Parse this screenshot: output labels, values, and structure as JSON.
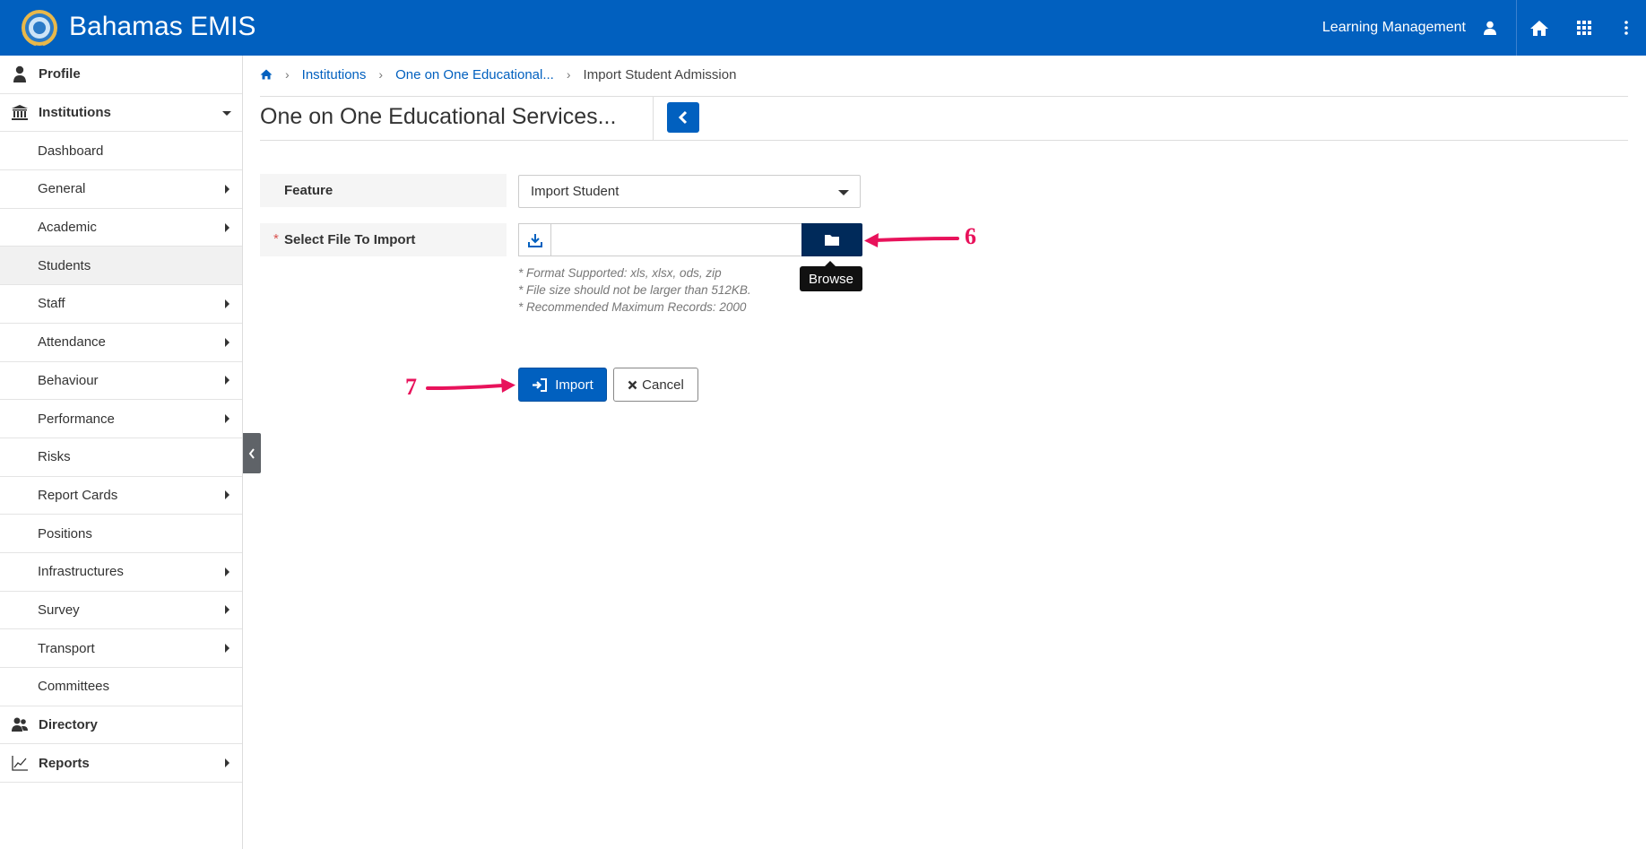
{
  "header": {
    "app_title": "Bahamas EMIS",
    "module_label": "Learning Management",
    "brand_color": "#0160bf",
    "icons": [
      "user-icon",
      "home-icon",
      "apps-grid-icon",
      "more-vertical-icon"
    ]
  },
  "sidebar": {
    "items": [
      {
        "label": "Profile",
        "level": "top",
        "icon": "user-icon"
      },
      {
        "label": "Institutions",
        "level": "top",
        "icon": "institution-icon",
        "expanded": true
      },
      {
        "label": "Dashboard",
        "level": "sub"
      },
      {
        "label": "General",
        "level": "sub",
        "has_children": true
      },
      {
        "label": "Academic",
        "level": "sub",
        "has_children": true
      },
      {
        "label": "Students",
        "level": "sub",
        "active": true
      },
      {
        "label": "Staff",
        "level": "sub",
        "has_children": true
      },
      {
        "label": "Attendance",
        "level": "sub",
        "has_children": true
      },
      {
        "label": "Behaviour",
        "level": "sub",
        "has_children": true
      },
      {
        "label": "Performance",
        "level": "sub",
        "has_children": true
      },
      {
        "label": "Risks",
        "level": "sub"
      },
      {
        "label": "Report Cards",
        "level": "sub",
        "has_children": true
      },
      {
        "label": "Positions",
        "level": "sub"
      },
      {
        "label": "Infrastructures",
        "level": "sub",
        "has_children": true
      },
      {
        "label": "Survey",
        "level": "sub",
        "has_children": true
      },
      {
        "label": "Transport",
        "level": "sub",
        "has_children": true
      },
      {
        "label": "Committees",
        "level": "sub"
      },
      {
        "label": "Directory",
        "level": "top",
        "icon": "directory-icon"
      },
      {
        "label": "Reports",
        "level": "top",
        "icon": "chart-icon",
        "has_children": true
      }
    ]
  },
  "breadcrumb": {
    "items": [
      "Institutions",
      "One on One Educational...",
      "Import Student Admission"
    ]
  },
  "page": {
    "title": "One on One Educational Services..."
  },
  "form": {
    "feature_label": "Feature",
    "feature_value": "Import Student",
    "required_mark": "*",
    "file_label": "Select File To Import",
    "browse_tooltip": "Browse",
    "help_lines": [
      "* Format Supported: xls, xlsx, ods, zip",
      "* File size should not be larger than 512KB.",
      "* Recommended Maximum Records: 2000"
    ],
    "import_label": "Import",
    "cancel_label": "Cancel"
  },
  "annotations": {
    "step_browse": "6",
    "step_import": "7",
    "color": "#e8125b"
  }
}
